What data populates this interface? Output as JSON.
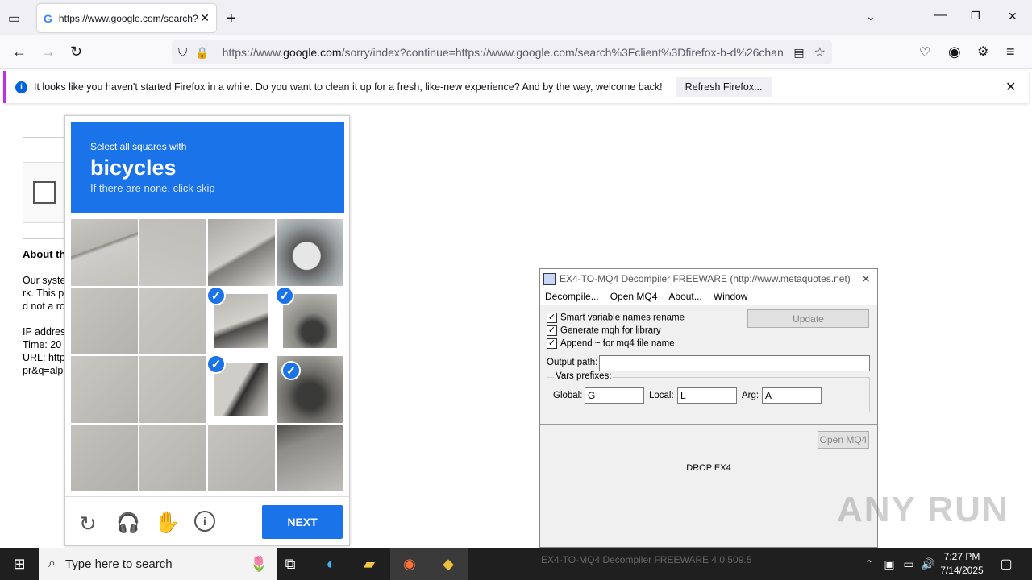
{
  "browser": {
    "tab_title": "https://www.google.com/search?",
    "url_prefix": "https://www.",
    "url_domain": "google.com",
    "url_rest": "/sorry/index?continue=https://www.google.com/search%3Fclient%3Dfirefox-b-d%26chan",
    "notification": "It looks like you haven't started Firefox in a while. Do you want to clean it up for a fresh, like-new experience? And by the way, welcome back!",
    "refresh_label": "Refresh Firefox..."
  },
  "page": {
    "about": "About th",
    "line1": "Our syste",
    "line2": "rk. This p",
    "line3": "d not a ro",
    "ip": "IP addres",
    "time": "Time: 20",
    "url": "URL: http",
    "q": "pr&q=alp"
  },
  "captcha": {
    "instruction": "Select all squares with",
    "target": "bicycles",
    "hint": "If there are none, click skip",
    "next_label": "NEXT",
    "check_glyph": "✓"
  },
  "decompiler": {
    "title": "EX4-TO-MQ4 Decompiler FREEWARE (http://www.metaquotes.net)",
    "menu": [
      "Decompile...",
      "Open MQ4",
      "About...",
      "Window"
    ],
    "opt1": "Smart variable names rename",
    "opt2": "Generate mqh for library",
    "opt3": "Append ~ for mq4 file name",
    "update_label": "Update",
    "output_label": "Output path:",
    "output_value": "",
    "vars_label": "Vars prefixes:",
    "global_label": "Global:",
    "global_value": "G",
    "local_label": "Local:",
    "local_value": "L",
    "arg_label": "Arg:",
    "arg_value": "A",
    "open_mq4_label": "Open MQ4",
    "drop_label": "DROP EX4",
    "status": "EX4-TO-MQ4 Decompiler FREEWARE  4.0.509.5"
  },
  "taskbar": {
    "search_placeholder": "Type here to search",
    "time": "7:27 PM",
    "date": "7/14/2025"
  },
  "watermark": "ANY RUN"
}
